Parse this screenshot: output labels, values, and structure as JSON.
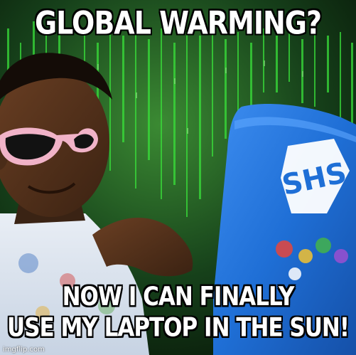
{
  "meme": {
    "top_text": "GLOBAL WARMING?",
    "bottom_text_line1": "NOW I CAN FINALLY",
    "bottom_text_line2": "USE MY LAPTOP IN THE SUN!",
    "laptop_logo": "SHS",
    "watermark": "imgflip.com"
  },
  "colors": {
    "matrix_green": "#2fd12f",
    "laptop_blue": "#1f6fd6",
    "caption_fill": "#ffffff",
    "caption_stroke": "#000000"
  }
}
